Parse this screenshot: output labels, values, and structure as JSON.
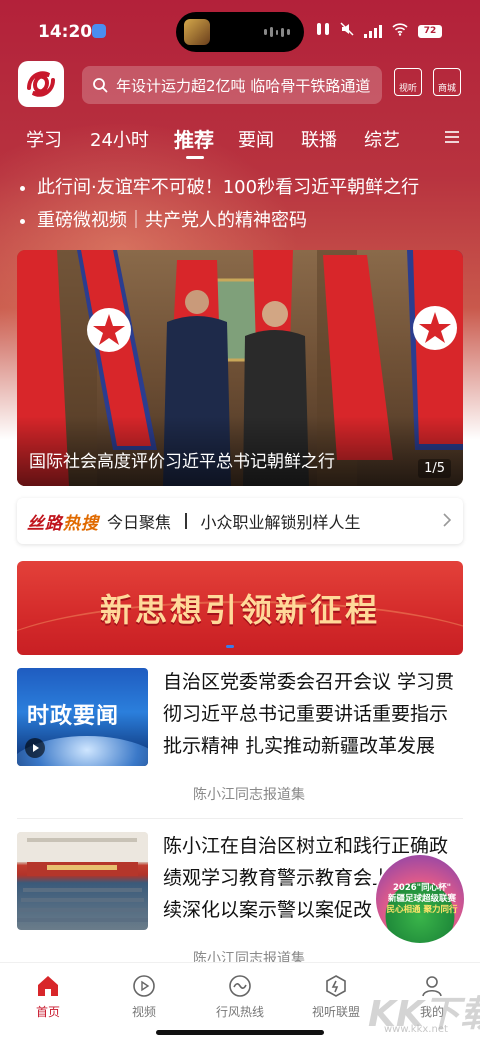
{
  "status_bar": {
    "time": "14:20",
    "battery": "72"
  },
  "search": {
    "placeholder": "年设计运力超2亿吨  临哈骨干铁路通道",
    "buttons": {
      "shiting": "视听",
      "shangcheng": "商城"
    }
  },
  "tabs": [
    {
      "label": "学习"
    },
    {
      "label": "24小时"
    },
    {
      "label": "推荐",
      "active": true
    },
    {
      "label": "要闻"
    },
    {
      "label": "联播"
    },
    {
      "label": "综艺"
    }
  ],
  "headlines": [
    {
      "text": "此行间·友谊牢不可破！100秒看习近平朝鲜之行"
    },
    {
      "text": "重磅微视频｜共产党人的精神密码"
    }
  ],
  "carousel": {
    "title": "国际社会高度评价习近平总书记朝鲜之行",
    "pager": "1/5"
  },
  "hot_search": {
    "brand_part1": "丝路",
    "brand_part2": "热搜",
    "items": [
      "今日聚焦",
      "小众职业解锁别样人生"
    ]
  },
  "banner": {
    "text": "新思想引领新征程"
  },
  "news": [
    {
      "thumb_label": "时政要闻",
      "title": "自治区党委常委会召开会议  学习贯彻习近平总书记重要讲话重要指示批示精神  扎实推动新疆改革发展",
      "source": "陈小江同志报道集"
    },
    {
      "title": "陈小江在自治区树立和践行正确政绩观学习教育警示教育会上强调  持续深化以案示警以案促改",
      "source": "陈小江同志报道集"
    }
  ],
  "promo": {
    "line1": "2026\"同心杯\"",
    "line2": "新疆足球超级联赛",
    "line3": "民心相通 聚力同行"
  },
  "bottom_nav": [
    {
      "label": "首页",
      "icon": "home-icon",
      "active": true
    },
    {
      "label": "视频",
      "icon": "video-icon"
    },
    {
      "label": "行风热线",
      "icon": "hotline-icon"
    },
    {
      "label": "视听联盟",
      "icon": "alliance-icon"
    },
    {
      "label": "我的",
      "icon": "profile-icon"
    }
  ],
  "watermark": {
    "text": "KK下载",
    "url": "www.kkx.net"
  },
  "colors": {
    "brand_red": "#c8182c",
    "header_red": "#b3213a",
    "banner_gold": "#ffd99a"
  }
}
